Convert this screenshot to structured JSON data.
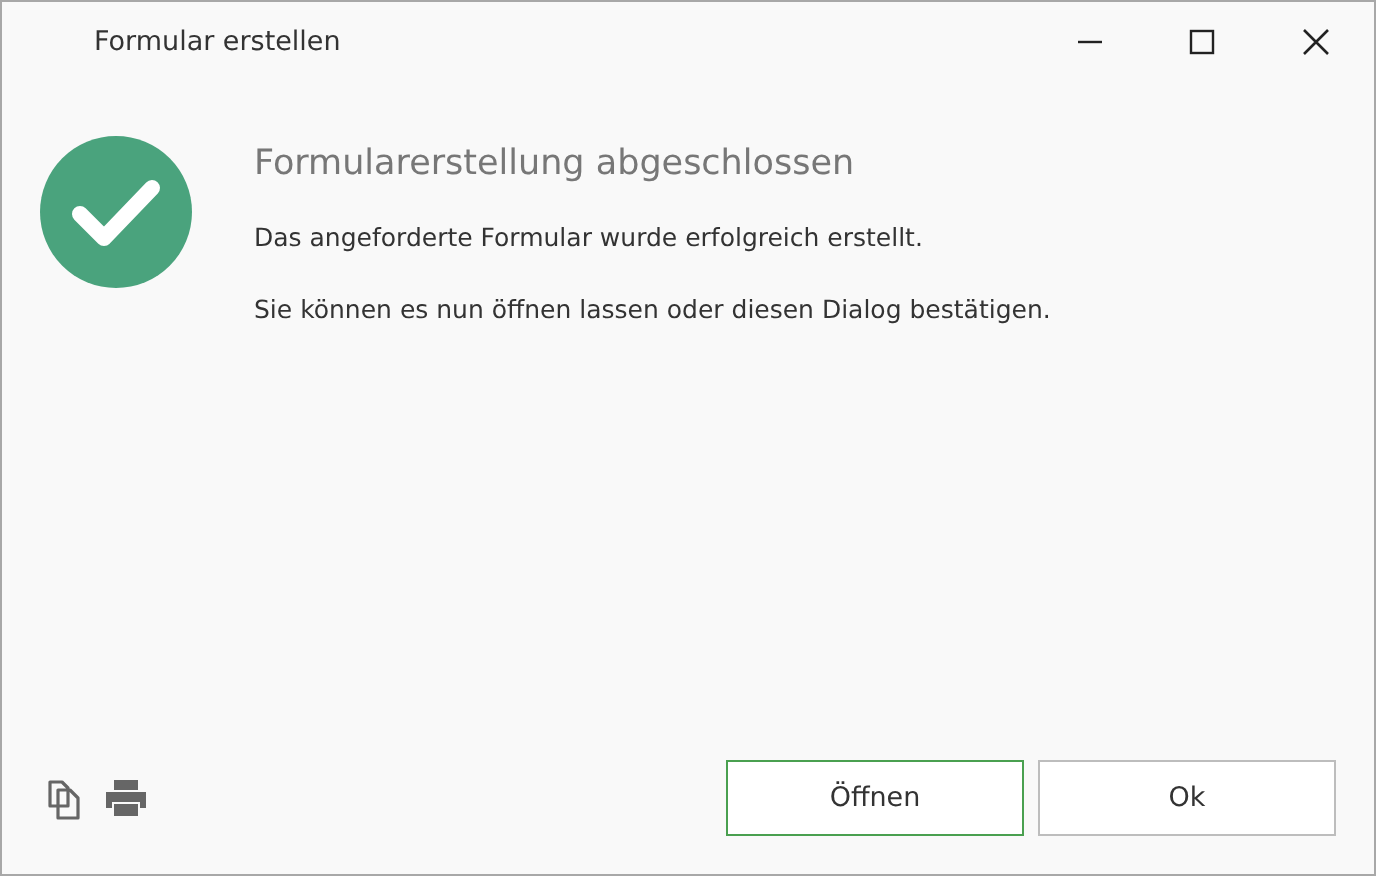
{
  "window": {
    "title": "Formular erstellen"
  },
  "status": {
    "kind": "success"
  },
  "heading": "Formularerstellung abgeschlossen",
  "messages": [
    "Das angeforderte Formular wurde erfolgreich erstellt.",
    "Sie können es nun öffnen lassen oder diesen Dialog bestätigen."
  ],
  "buttons": [
    {
      "label": "Öffnen",
      "focused": true
    },
    {
      "label": "Ok",
      "focused": false
    }
  ]
}
